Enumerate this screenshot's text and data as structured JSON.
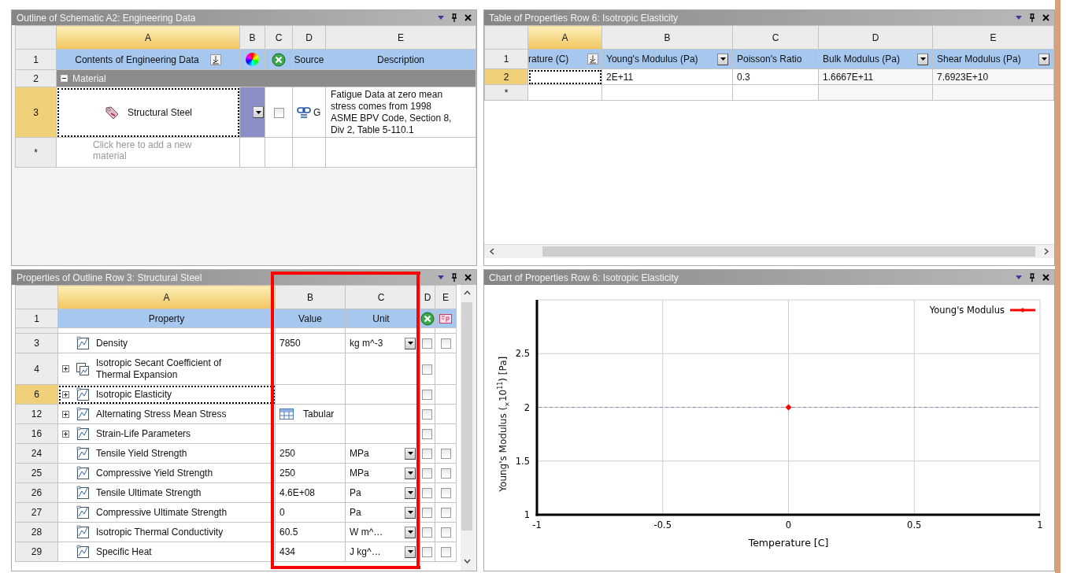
{
  "outline": {
    "title": "Outline of Schematic A2: Engineering Data",
    "columns": [
      {
        "label": "A",
        "selected": true
      },
      {
        "label": "B",
        "selected": false
      },
      {
        "label": "C",
        "selected": false
      },
      {
        "label": "D",
        "selected": false
      },
      {
        "label": "E",
        "selected": false
      }
    ],
    "header": {
      "num": "1",
      "contents": "Contents of Engineering Data",
      "source": "Source",
      "description": "Description"
    },
    "rows": [
      {
        "kind": "group",
        "num": "2",
        "label": "Material",
        "expanded": true,
        "selected": false
      },
      {
        "kind": "material",
        "num": "3",
        "label": "Structural Steel",
        "selected": true,
        "checked": false,
        "source": "G",
        "description": "Fatigue Data at zero mean stress comes from 1998 ASME BPV Code, Section 8, Div 2, Table 5-110.1"
      },
      {
        "kind": "new",
        "num": "*",
        "placeholder": "Click here to add a new material",
        "selected": false
      }
    ]
  },
  "elasticity_table": {
    "title": "Table of Properties Row 6: Isotropic Elasticity",
    "columns": [
      {
        "label": "A",
        "selected": true
      },
      {
        "label": "B",
        "selected": false
      },
      {
        "label": "C",
        "selected": false
      },
      {
        "label": "D",
        "selected": false
      },
      {
        "label": "E",
        "selected": false
      }
    ],
    "header": {
      "num": "1",
      "cells": [
        {
          "text": "rature (C)",
          "kind": "sort"
        },
        {
          "text": "Young's Modulus (Pa)",
          "kind": "filter"
        },
        {
          "text": "Poisson's Ratio",
          "kind": "plain"
        },
        {
          "text": "Bulk Modulus (Pa)",
          "kind": "filter"
        },
        {
          "text": "Shear Modulus (Pa)",
          "kind": "filter"
        }
      ]
    },
    "rows": [
      {
        "num": "2",
        "selected": true,
        "values": [
          "2E+11",
          "0.3",
          "1.6667E+11",
          "7.6923E+10"
        ]
      },
      {
        "num": "*",
        "selected": false,
        "values": []
      }
    ]
  },
  "properties": {
    "title": "Properties of Outline Row 3: Structural Steel",
    "columns": [
      {
        "label": "A",
        "selected": true
      },
      {
        "label": "B",
        "selected": false
      },
      {
        "label": "C",
        "selected": false
      },
      {
        "label": "D",
        "selected": false
      },
      {
        "label": "E",
        "selected": false
      }
    ],
    "header": {
      "num": "1",
      "property": "Property",
      "value": "Value",
      "unit": "Unit"
    },
    "rows": [
      {
        "kind": "value",
        "num": "3",
        "label": "Density",
        "value": "7850",
        "unit": "kg m^-3",
        "selected": false,
        "checked_d": false,
        "checked_e": false
      },
      {
        "kind": "group",
        "num": "4",
        "label": "Isotropic Secant Coefficient of Thermal Expansion",
        "expanded": false,
        "selected": false,
        "checked_d": false
      },
      {
        "kind": "group",
        "num": "6",
        "label": "Isotropic Elasticity",
        "expanded": false,
        "selected": true,
        "checked_d": false
      },
      {
        "kind": "group",
        "num": "12",
        "label": "Alternating Stress Mean Stress",
        "expanded": false,
        "selected": false,
        "value": "Tabular",
        "checked_d": false
      },
      {
        "kind": "group",
        "num": "16",
        "label": "Strain-Life Parameters",
        "expanded": false,
        "selected": false,
        "checked_d": false
      },
      {
        "kind": "value",
        "num": "24",
        "label": "Tensile Yield Strength",
        "value": "250",
        "unit": "MPa",
        "selected": false,
        "checked_d": false,
        "checked_e": false
      },
      {
        "kind": "value",
        "num": "25",
        "label": "Compressive Yield Strength",
        "value": "250",
        "unit": "MPa",
        "selected": false,
        "checked_d": false,
        "checked_e": false
      },
      {
        "kind": "value",
        "num": "26",
        "label": "Tensile Ultimate Strength",
        "value": "4.6E+08",
        "unit": "Pa",
        "selected": false,
        "checked_d": false,
        "checked_e": false
      },
      {
        "kind": "value",
        "num": "27",
        "label": "Compressive Ultimate Strength",
        "value": "0",
        "unit": "Pa",
        "selected": false,
        "checked_d": false,
        "checked_e": false
      },
      {
        "kind": "value",
        "num": "28",
        "label": "Isotropic Thermal Conductivity",
        "value": "60.5",
        "unit": "W m^…",
        "selected": false,
        "checked_d": false,
        "checked_e": false
      },
      {
        "kind": "value",
        "num": "29",
        "label": "Specific Heat",
        "value": "434",
        "unit": "J kg^…",
        "selected": false,
        "checked_d": false,
        "checked_e": false
      }
    ]
  },
  "chart": {
    "title": "Chart of Properties Row 6: Isotropic Elasticity",
    "chart_data": {
      "type": "line",
      "xlabel": "Temperature [C]",
      "ylabel": "Young's Modulus  ($_{×}$10$^{11}$)  [Pa]",
      "x": [
        0
      ],
      "series": [
        {
          "name": "Young's Modulus",
          "color": "#ff0000",
          "marker": "diamond",
          "values": [
            2
          ]
        }
      ],
      "grid": true,
      "ref_lines": [
        {
          "axis": "y",
          "value": 2,
          "color": "#8a8fc0"
        }
      ],
      "xlim": [
        -1,
        1
      ],
      "ylim": [
        1,
        3
      ],
      "xticks": [
        -1,
        -0.5,
        0,
        0.5,
        1
      ],
      "yticks": [
        1,
        1.5,
        2,
        2.5
      ]
    }
  }
}
